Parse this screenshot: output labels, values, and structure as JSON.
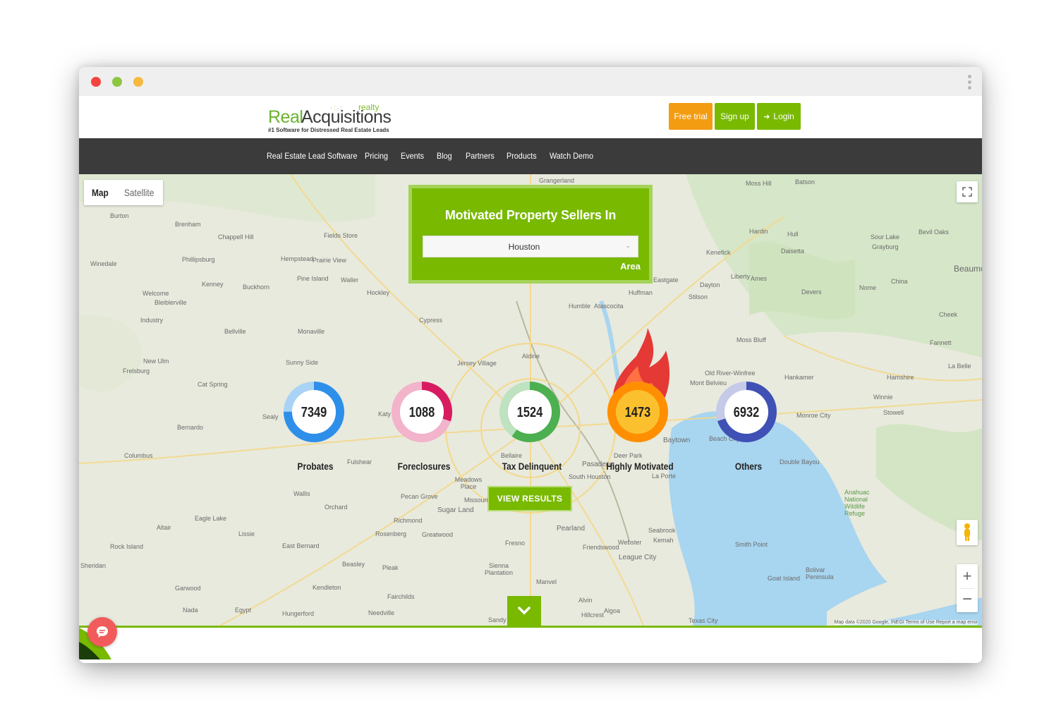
{
  "window": {
    "dot_colors": [
      "#f5433e",
      "#8dc63f",
      "#f6b940"
    ],
    "kebab_icon": "more-vertical-icon"
  },
  "header": {
    "logo": {
      "real": "Real",
      "acquisitions": "Acquisitions",
      "realty": "realty",
      "tagline": "#1 Software for Distressed Real Estate Leads"
    },
    "buttons": {
      "free_trial": "Free trial",
      "sign_up": "Sign up",
      "login": "Login"
    },
    "colors": {
      "free_trial": "#f39c12",
      "green": "#79b900"
    }
  },
  "nav": {
    "items": [
      "Real Estate Lead Software",
      "Pricing",
      "Events",
      "Blog",
      "Partners",
      "Products",
      "Watch Demo"
    ]
  },
  "map": {
    "toggle": {
      "map": "Map",
      "satellite": "Satellite"
    },
    "labels": [
      "Burton",
      "Brenham",
      "Chappell Hill",
      "Fields Store",
      "Grangerland",
      "Moss Hill",
      "Batson",
      "Hardin",
      "Hull",
      "Sour Lake",
      "Grayburg",
      "Bevil Oaks",
      "Beaumont",
      "Winedale",
      "Phillipsburg",
      "Hempstead",
      "Prairie View",
      "Kenefick",
      "Daisetta",
      "Kenney",
      "Pine Island",
      "Waller",
      "Eastgate",
      "Dayton",
      "Liberty",
      "Ames",
      "Nome",
      "China",
      "Welcome",
      "Bleiblerville",
      "Buckhorn",
      "Hockley",
      "Huffman",
      "Stilson",
      "Devers",
      "Industry",
      "Humble",
      "Atascocita",
      "Cheek",
      "Bellville",
      "Monaville",
      "Cypress",
      "Aldine",
      "Moss Bluff",
      "Fannett",
      "New Ulm",
      "Frelsburg",
      "Sunny Side",
      "Jersey Village",
      "Hankamer",
      "Hamshire",
      "La Belle",
      "Cat Spring",
      "Mont Belvieu",
      "Old River-Winfree",
      "Winnie",
      "Sealy",
      "Katy",
      "Stowell",
      "Monroe City",
      "Bernardo",
      "Baytown",
      "Beach City",
      "Columbus",
      "Fulshear",
      "Bellaire",
      "Pasadena",
      "Deer Park",
      "Double Bayou",
      "Meadows Place",
      "South Houston",
      "La Porte",
      "Wallis",
      "Orchard",
      "Pecan Grove",
      "Missouri City",
      "Sugar Land",
      "Eagle Lake",
      "Richmond",
      "Pearland",
      "Anahuac National Wildlife Refuge",
      "Altair",
      "Lissie",
      "Rosenberg",
      "Greatwood",
      "Seabrook",
      "Kemah",
      "Smith Point",
      "Rock Island",
      "East Bernard",
      "Fresno",
      "Friendswood",
      "Webster",
      "League City",
      "Sheridan",
      "Beasley",
      "Pleak",
      "Sienna Plantation",
      "Bolivar Peninsula",
      "Goat Island",
      "Garwood",
      "Kendleton",
      "Manvel",
      "Fairchilds",
      "Alvin",
      "Nada",
      "Egypt",
      "Hungerford",
      "Needville",
      "Hillcrest",
      "Algoa",
      "Texas City",
      "Sandy Point"
    ],
    "attribution": "Map data ©2020 Google, INEGI   Terms of Use   Report a map error"
  },
  "seller_box": {
    "title": "Motivated Property Sellers In",
    "area_value": "Houston",
    "area_label": "Area"
  },
  "stats": [
    {
      "label": "Probates",
      "value": "7349",
      "main": "#2e8fea",
      "track": "#a9d3f6",
      "fraction": 0.75
    },
    {
      "label": "Foreclosures",
      "value": "1088",
      "main": "#d81b60",
      "track": "#f2b3cb",
      "fraction": 0.3
    },
    {
      "label": "Tax Delinquent",
      "value": "1524",
      "main": "#4caf50",
      "track": "#bfe2c0",
      "fraction": 0.6
    },
    {
      "label": "Highly Motivated",
      "value": "1473",
      "main": "#ff8f00",
      "track": "#fbc02d",
      "fraction": 1.0
    },
    {
      "label": "Others",
      "value": "6932",
      "main": "#3f51b5",
      "track": "#c5cae9",
      "fraction": 0.7
    }
  ],
  "view_results": "VIEW RESULTS",
  "icons": {
    "login": "login-icon",
    "down": "chevron-down-icon",
    "chat": "chat-icon",
    "fullscreen": "fullscreen-icon",
    "pegman": "street-view-icon",
    "zoom_in": "zoom-in-icon",
    "zoom_out": "zoom-out-icon",
    "select": "chevron-down-icon",
    "fire": "fire-icon"
  }
}
